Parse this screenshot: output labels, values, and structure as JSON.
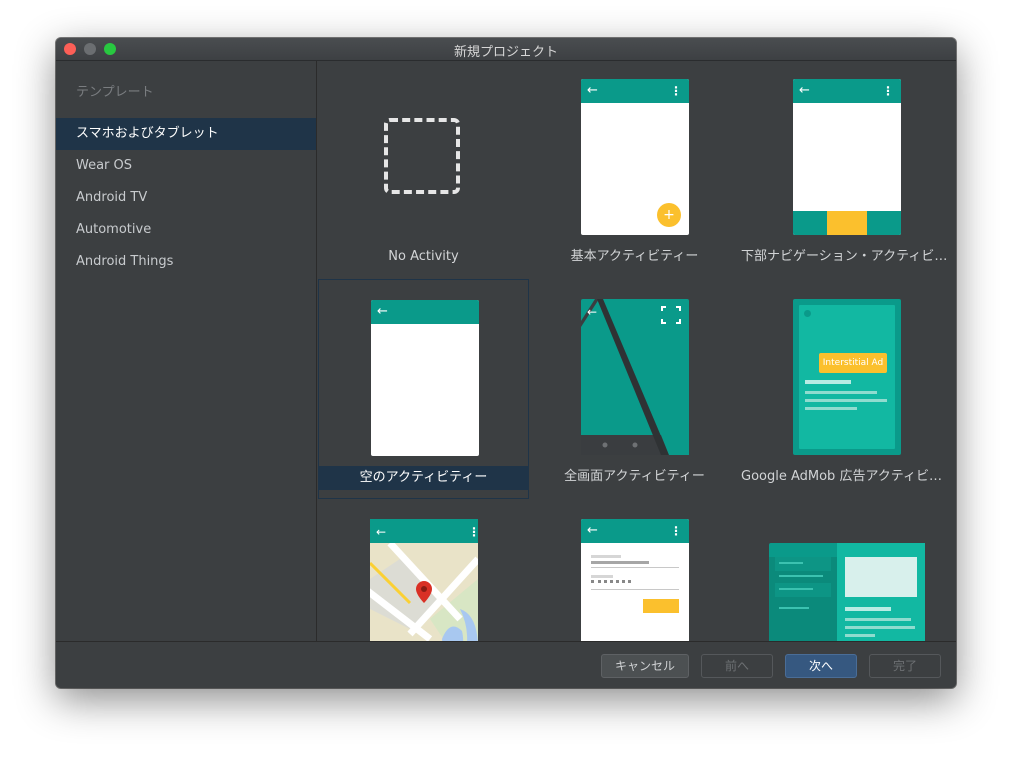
{
  "window": {
    "title": "新規プロジェクト"
  },
  "sidebar": {
    "header": "テンプレート",
    "items": [
      {
        "label": "スマホおよびタブレット",
        "selected": true
      },
      {
        "label": "Wear OS"
      },
      {
        "label": "Android TV"
      },
      {
        "label": "Automotive"
      },
      {
        "label": "Android Things"
      }
    ]
  },
  "templates": [
    {
      "label": "No Activity"
    },
    {
      "label": "基本アクティビティー"
    },
    {
      "label": "下部ナビゲーション・アクティビテ..."
    },
    {
      "label": "空のアクティビティー",
      "selected": true
    },
    {
      "label": "全画面アクティビティー"
    },
    {
      "label": "Google AdMob 広告アクティビティー",
      "ad_tag": "Interstitial Ad"
    },
    {
      "label": ""
    },
    {
      "label": ""
    },
    {
      "label": ""
    }
  ],
  "footer": {
    "cancel": "キャンセル",
    "previous": "前へ",
    "next": "次へ",
    "finish": "完了"
  },
  "colors": {
    "accent": "#0a9a8a",
    "fab": "#fbc02d",
    "selection": "#1f3448",
    "primary_button": "#365880"
  }
}
